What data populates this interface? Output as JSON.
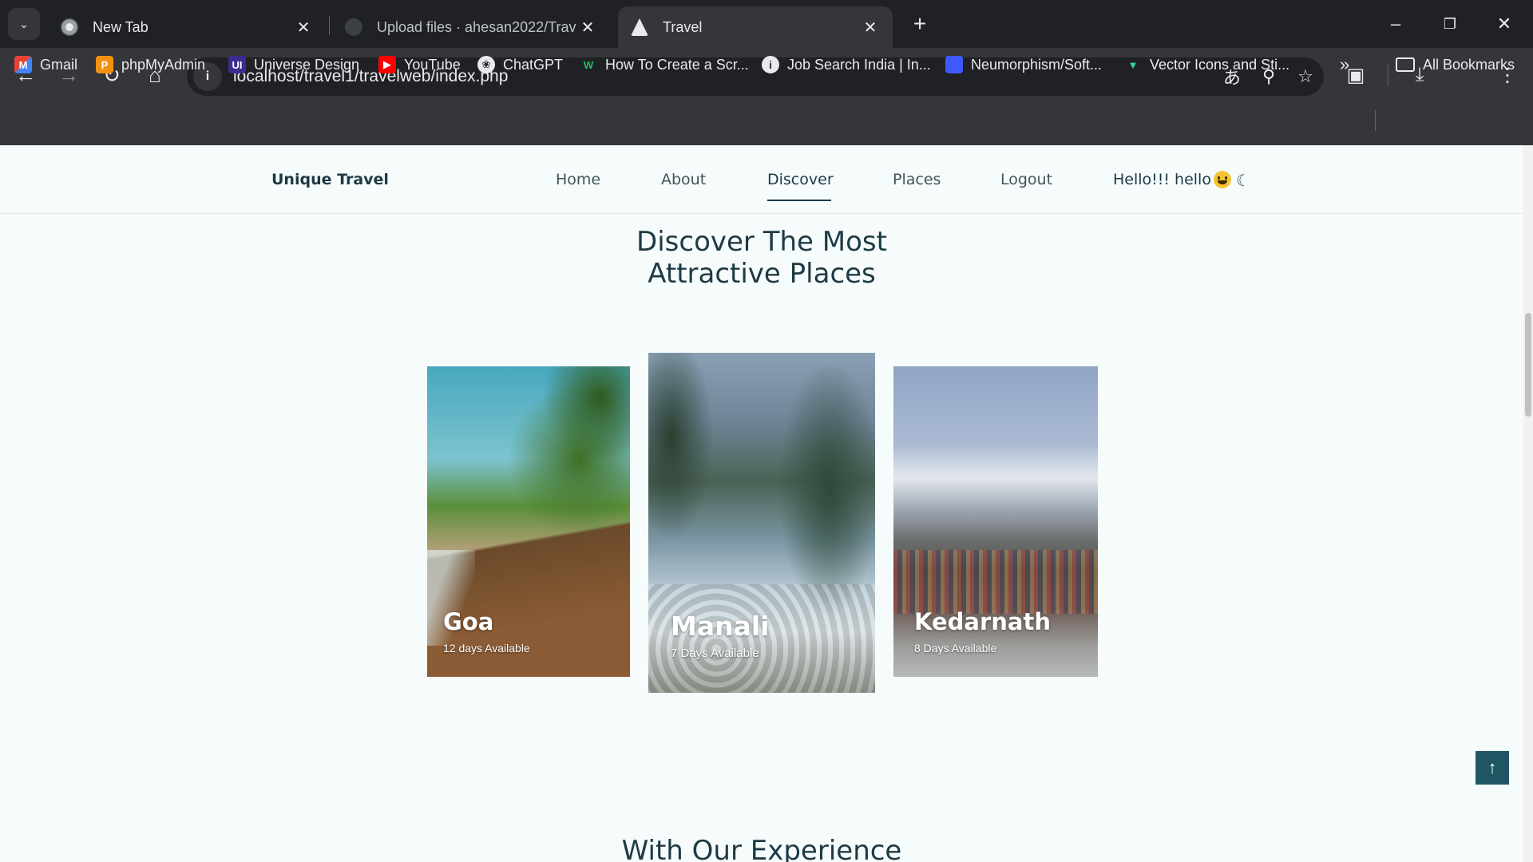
{
  "browser": {
    "tabs": [
      {
        "title": "New Tab",
        "active": false
      },
      {
        "title": "Upload files · ahesan2022/Trave",
        "active": false
      },
      {
        "title": "Travel",
        "active": true
      }
    ],
    "url": "localhost/travel1/travelweb/index.php",
    "bookmarks": [
      {
        "label": "Gmail",
        "icon": "gmail-icon"
      },
      {
        "label": "phpMyAdmin",
        "icon": "phpmyadmin-icon"
      },
      {
        "label": "Universe Design",
        "icon": "ui-icon"
      },
      {
        "label": "YouTube",
        "icon": "youtube-icon"
      },
      {
        "label": "ChatGPT",
        "icon": "chatgpt-icon"
      },
      {
        "label": "How To Create a Scr...",
        "icon": "w-icon"
      },
      {
        "label": "Job Search India | In...",
        "icon": "info-icon"
      },
      {
        "label": "Neumorphism/Soft...",
        "icon": "square-icon"
      },
      {
        "label": "Vector Icons and Sti...",
        "icon": "v-icon"
      }
    ],
    "all_bookmarks": "All Bookmarks",
    "colors": {
      "chrome_dark": "#202124",
      "chrome_mid": "#35363a",
      "chrome_text": "#e8eaed"
    }
  },
  "site": {
    "logo": "Unique Travel",
    "nav": [
      {
        "label": "Home",
        "active": false
      },
      {
        "label": "About",
        "active": false
      },
      {
        "label": "Discover",
        "active": true
      },
      {
        "label": "Places",
        "active": false
      },
      {
        "label": "Logout",
        "active": false
      }
    ],
    "greeting": "Hello!!! hello",
    "section_title_line1": "Discover The Most",
    "section_title_line2": "Attractive Places",
    "cards": [
      {
        "name": "Goa",
        "sub": "12 days Available"
      },
      {
        "name": "Manali",
        "sub": "7 Days Available"
      },
      {
        "name": "Kedarnath",
        "sub": "8 Days Available"
      }
    ],
    "next_section_title": "With Our Experience",
    "colors": {
      "primary": "#1e3a44",
      "accent": "#1e5763",
      "page_bg": "#f6fbfc"
    }
  }
}
